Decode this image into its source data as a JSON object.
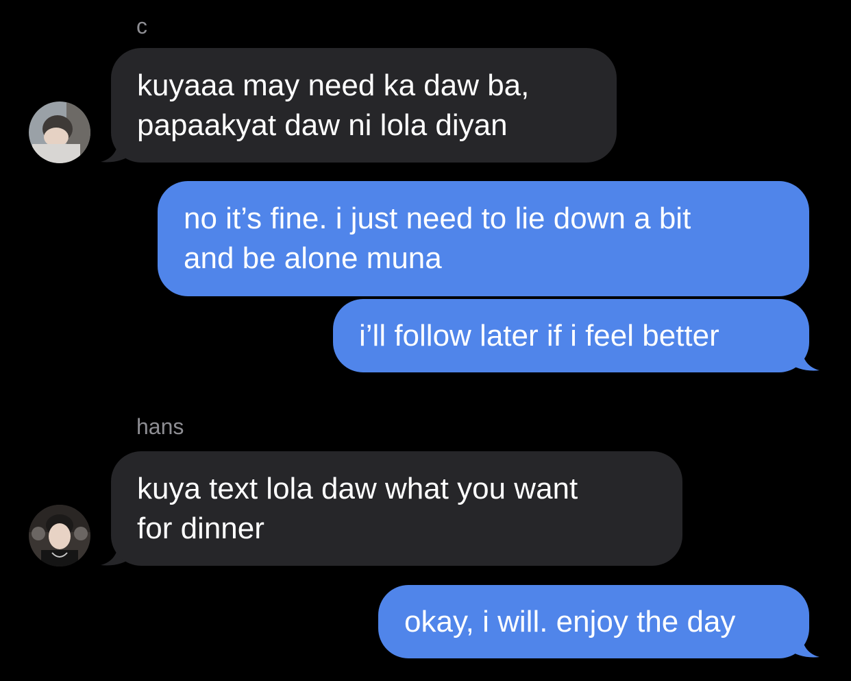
{
  "conversation": [
    {
      "sender": "c",
      "direction": "incoming",
      "lines": [
        "kuyaaa may need ka daw ba,",
        "papaakyat daw ni lola diyan"
      ]
    },
    {
      "direction": "outgoing",
      "lines": [
        "no it’s fine. i just need to lie down a bit",
        "and be alone muna"
      ]
    },
    {
      "direction": "outgoing",
      "lines": [
        "i’ll follow later if i feel better"
      ]
    },
    {
      "sender": "hans",
      "direction": "incoming",
      "lines": [
        "kuya text lola daw what you want",
        "for dinner"
      ]
    },
    {
      "direction": "outgoing",
      "lines": [
        "okay, i will. enjoy the day"
      ]
    }
  ],
  "colors": {
    "incoming_bubble": "#262629",
    "outgoing_bubble": "#5085ea",
    "sender_name": "#8e8e93",
    "background": "#000000"
  }
}
